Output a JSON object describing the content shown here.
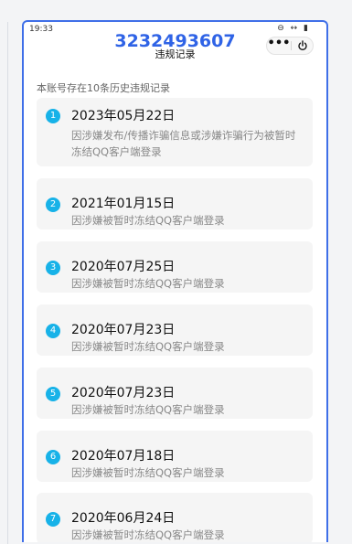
{
  "status": {
    "time": "19:33",
    "icons": "⊖ ↔ ▮"
  },
  "header": {
    "account": "3232493607",
    "subtitle": "违规记录"
  },
  "capsule": {
    "more_label": "•••"
  },
  "summary": "本账号存在10条历史违规记录",
  "records": [
    {
      "num": "1",
      "date": "2023年05月22日",
      "desc": "因涉嫌发布/传播诈骗信息或涉嫌诈骗行为被暂时冻结QQ客户端登录"
    },
    {
      "num": "2",
      "date": "2021年01月15日",
      "desc": "因涉嫌被暂时冻结QQ客户端登录"
    },
    {
      "num": "3",
      "date": "2020年07月25日",
      "desc": "因涉嫌被暂时冻结QQ客户端登录"
    },
    {
      "num": "4",
      "date": "2020年07月23日",
      "desc": "因涉嫌被暂时冻结QQ客户端登录"
    },
    {
      "num": "5",
      "date": "2020年07月23日",
      "desc": "因涉嫌被暂时冻结QQ客户端登录"
    },
    {
      "num": "6",
      "date": "2020年07月18日",
      "desc": "因涉嫌被暂时冻结QQ客户端登录"
    },
    {
      "num": "7",
      "date": "2020年06月24日",
      "desc": "因涉嫌被暂时冻结QQ客户端登录"
    }
  ]
}
